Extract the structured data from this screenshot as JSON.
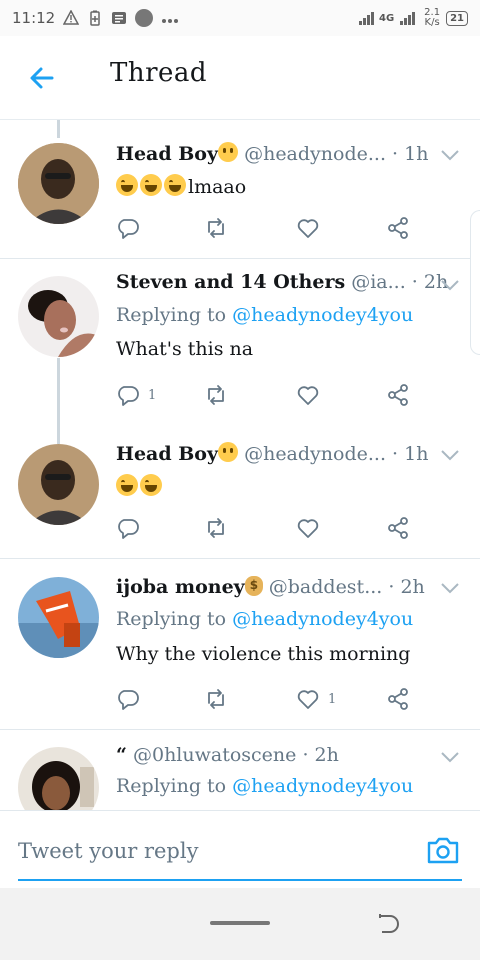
{
  "status_bar": {
    "time": "11:12",
    "network": "4G",
    "speed_value": "2.1",
    "speed_unit": "K/s",
    "battery": "21"
  },
  "header": {
    "title": "Thread",
    "back_icon": "arrow-left-icon"
  },
  "tweets": [
    {
      "name": "Head Boy",
      "name_emoji": "neutral-face",
      "handle": "@headynode...",
      "time": "· 1h",
      "body_emojis": 3,
      "body": "lmaao",
      "reply_count": "",
      "retweet_count": "",
      "like_count": ""
    },
    {
      "name": "Steven and 14 Others",
      "handle": "@ia...",
      "time": "· 2h",
      "replying_prefix": "Replying to",
      "replying_to": "@headynodey4you",
      "body": "What's this na",
      "reply_count": "1",
      "retweet_count": "",
      "like_count": ""
    },
    {
      "name": "Head Boy",
      "name_emoji": "neutral-face",
      "handle": "@headynode...",
      "time": "· 1h",
      "body_emojis": 2,
      "body": "",
      "reply_count": "",
      "retweet_count": "",
      "like_count": ""
    },
    {
      "name": "ijoba money",
      "name_emoji": "money-bag",
      "handle": "@baddest...",
      "time": "· 2h",
      "replying_prefix": "Replying to",
      "replying_to": "@headynodey4you",
      "body": "Why the violence this morning",
      "reply_count": "",
      "retweet_count": "",
      "like_count": "1"
    },
    {
      "name": "“",
      "handle": "@0hluwatoscene",
      "time": "· 2h",
      "replying_prefix": "Replying to",
      "replying_to": "@headynodey4you"
    }
  ],
  "reply_bar": {
    "placeholder": "Tweet your reply",
    "camera_icon": "camera-icon"
  },
  "colors": {
    "accent": "#1da1f2",
    "muted": "#657786",
    "divider": "#e1e8ed"
  }
}
